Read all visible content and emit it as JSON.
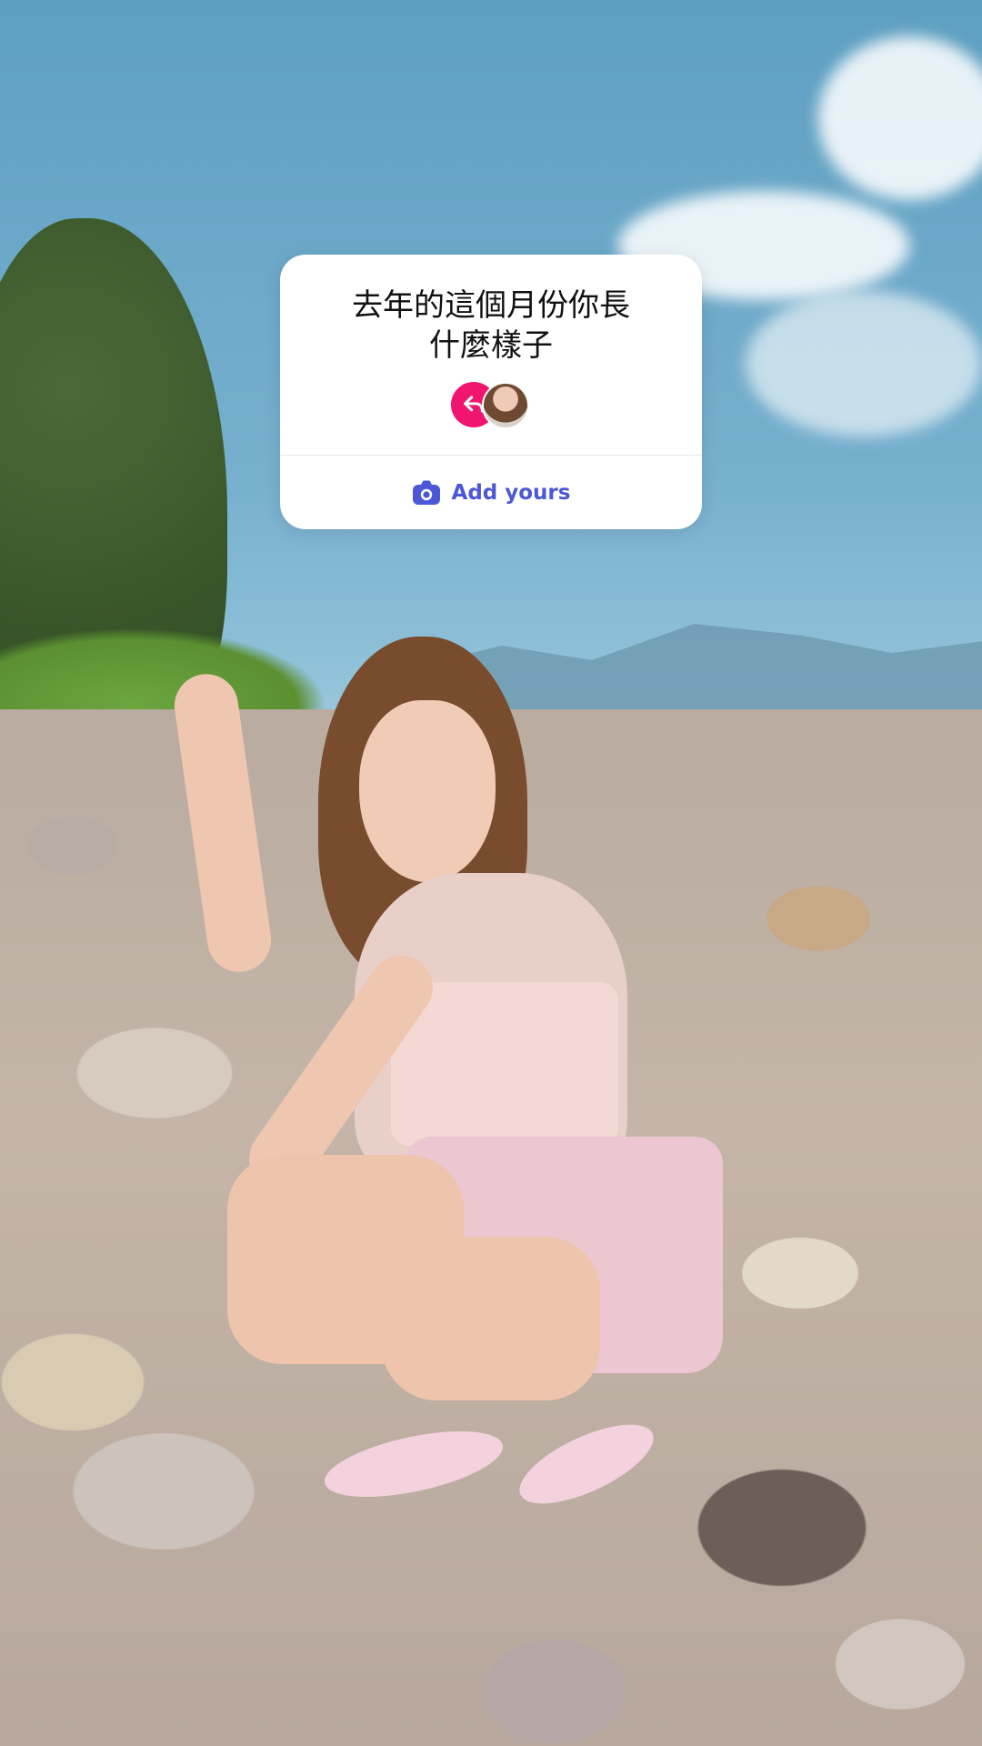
{
  "story": {
    "background": {
      "description_icon": "photo",
      "colors": {
        "sky": "#78b0cf",
        "foliage": "#4c6a38",
        "rocks": "#c4b5a8"
      }
    }
  },
  "add_yours_sticker": {
    "prompt": "去年的這個月份你長什麼樣子",
    "prompt_line1": "去年的這個月份你長",
    "prompt_line2": "什麼樣子",
    "reply_icon": "reply-arrow-icon",
    "avatar_icon": "avatar",
    "action_label": "Add yours",
    "action_icon": "camera-icon",
    "colors": {
      "accent": "#4b57d8",
      "badge": "#f0156f",
      "card": "#ffffff"
    }
  }
}
